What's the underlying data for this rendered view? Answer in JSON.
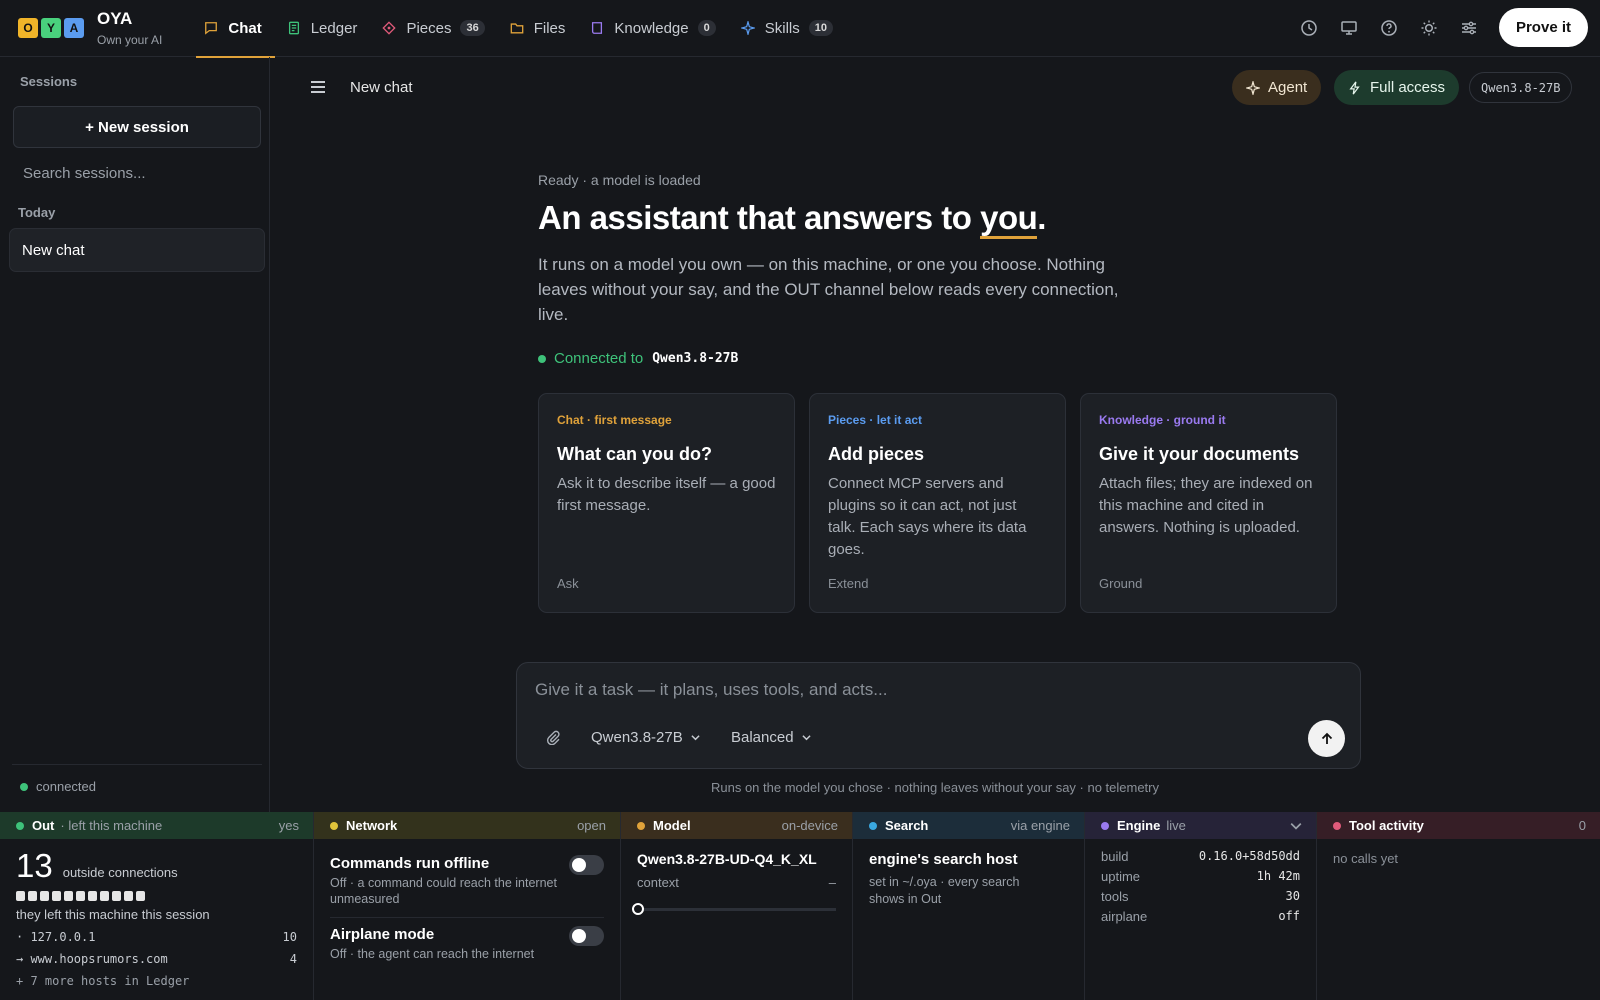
{
  "brand": {
    "tiles": [
      {
        "letter": "O",
        "color": "#f0b429"
      },
      {
        "letter": "Y",
        "color": "#49d17d"
      },
      {
        "letter": "A",
        "color": "#5b9cf0"
      }
    ],
    "name": "OYA",
    "tagline": "Own your AI"
  },
  "nav": [
    {
      "label": "Chat",
      "icon": "chat-bubble-icon",
      "color": "#e0a23a",
      "active": true
    },
    {
      "label": "Ledger",
      "icon": "ledger-icon",
      "color": "#3ec27a"
    },
    {
      "label": "Pieces",
      "icon": "puzzle-icon",
      "color": "#e05a7a",
      "badge": "36"
    },
    {
      "label": "Files",
      "icon": "folder-icon",
      "color": "#e0a23a"
    },
    {
      "label": "Knowledge",
      "icon": "book-icon",
      "color": "#9a7af0",
      "badge": "0"
    },
    {
      "label": "Skills",
      "icon": "sparkle-icon",
      "color": "#5b9cf0",
      "badge": "10"
    }
  ],
  "top_actions": {
    "icons": [
      "history-icon",
      "monitor-icon",
      "help-icon",
      "sun-icon",
      "settings-sliders-icon"
    ],
    "prove_label": "Prove it"
  },
  "sidebar": {
    "title": "Sessions",
    "new_session": "+ New session",
    "search_placeholder": "Search sessions...",
    "group_label": "Today",
    "items": [
      {
        "label": "New chat"
      }
    ],
    "status": "connected"
  },
  "header": {
    "title": "New chat",
    "agent_label": "Agent",
    "access_label": "Full access",
    "model_label": "Qwen3.8-27B"
  },
  "hero": {
    "status": "Ready · a model is loaded",
    "title_pre": "An assistant that answers to ",
    "title_em": "you",
    "title_post": ".",
    "description": "It runs on a model you own — on this machine, or one you choose. Nothing leaves without your say, and the OUT channel below reads every connection, live.",
    "connected_label": "Connected to",
    "connected_model": "Qwen3.8-27B"
  },
  "cards": [
    {
      "kicker": "Chat · first message",
      "color": "#e0a23a",
      "title": "What can you do?",
      "body": "Ask it to describe itself — a good first message.",
      "foot": "Ask"
    },
    {
      "kicker": "Pieces · let it act",
      "color": "#5b9cf0",
      "title": "Add pieces",
      "body": "Connect MCP servers and plugins so it can act, not just talk. Each says where its data goes.",
      "foot": "Extend"
    },
    {
      "kicker": "Knowledge · ground it",
      "color": "#9a7af0",
      "title": "Give it your documents",
      "body": "Attach files; they are indexed on this machine and cited in answers. Nothing is uploaded.",
      "foot": "Ground"
    }
  ],
  "composer": {
    "placeholder": "Give it a task — it plans, uses tools, and acts...",
    "model": "Qwen3.8-27B",
    "mode": "Balanced",
    "footnote": "Runs on the model you chose · nothing leaves without your say · no telemetry"
  },
  "panels": {
    "out": {
      "name": "Out",
      "sub": "· left this machine",
      "right": "yes",
      "color": "#3ec27a",
      "bg": "#1d3a2a",
      "count": "13",
      "count_label": "outside connections",
      "squares": 11,
      "note": "they left this machine this session",
      "hosts": [
        {
          "host": "· 127.0.0.1",
          "count": "10"
        },
        {
          "host": "→ www.hoopsrumors.com",
          "count": "4"
        }
      ],
      "more": "+ 7 more hosts in Ledger"
    },
    "network": {
      "name": "Network",
      "right": "open",
      "color": "#e0c43a",
      "bg": "#33321c",
      "toggles": [
        {
          "title": "Commands run offline",
          "desc": "Off · a command could reach the internet unmeasured",
          "on": false
        },
        {
          "title": "Airplane mode",
          "desc": "Off · the agent can reach the internet",
          "on": false
        }
      ]
    },
    "model": {
      "name": "Model",
      "right": "on-device",
      "color": "#e0a23a",
      "bg": "#3a2e1e",
      "model_name": "Qwen3.8-27B-UD-Q4_K_XL",
      "context_label": "context",
      "context_value": "–",
      "context_fill": 0
    },
    "search": {
      "name": "Search",
      "right": "via engine",
      "color": "#3aa8e0",
      "bg": "#1c2d3a",
      "host": "engine's search host",
      "note": "set in ~/.oya · every search shows in Out"
    },
    "engine": {
      "name": "Engine",
      "sub": "live",
      "color": "#9a7af0",
      "bg": "#262338",
      "rows": [
        {
          "k": "build",
          "v": "0.16.0+58d50dd"
        },
        {
          "k": "uptime",
          "v": "1h 42m"
        },
        {
          "k": "tools",
          "v": "30"
        },
        {
          "k": "airplane",
          "v": "off"
        }
      ]
    },
    "tools": {
      "name": "Tool activity",
      "right": "0",
      "color": "#e05a7a",
      "bg": "#361e26",
      "empty": "no calls yet"
    }
  }
}
